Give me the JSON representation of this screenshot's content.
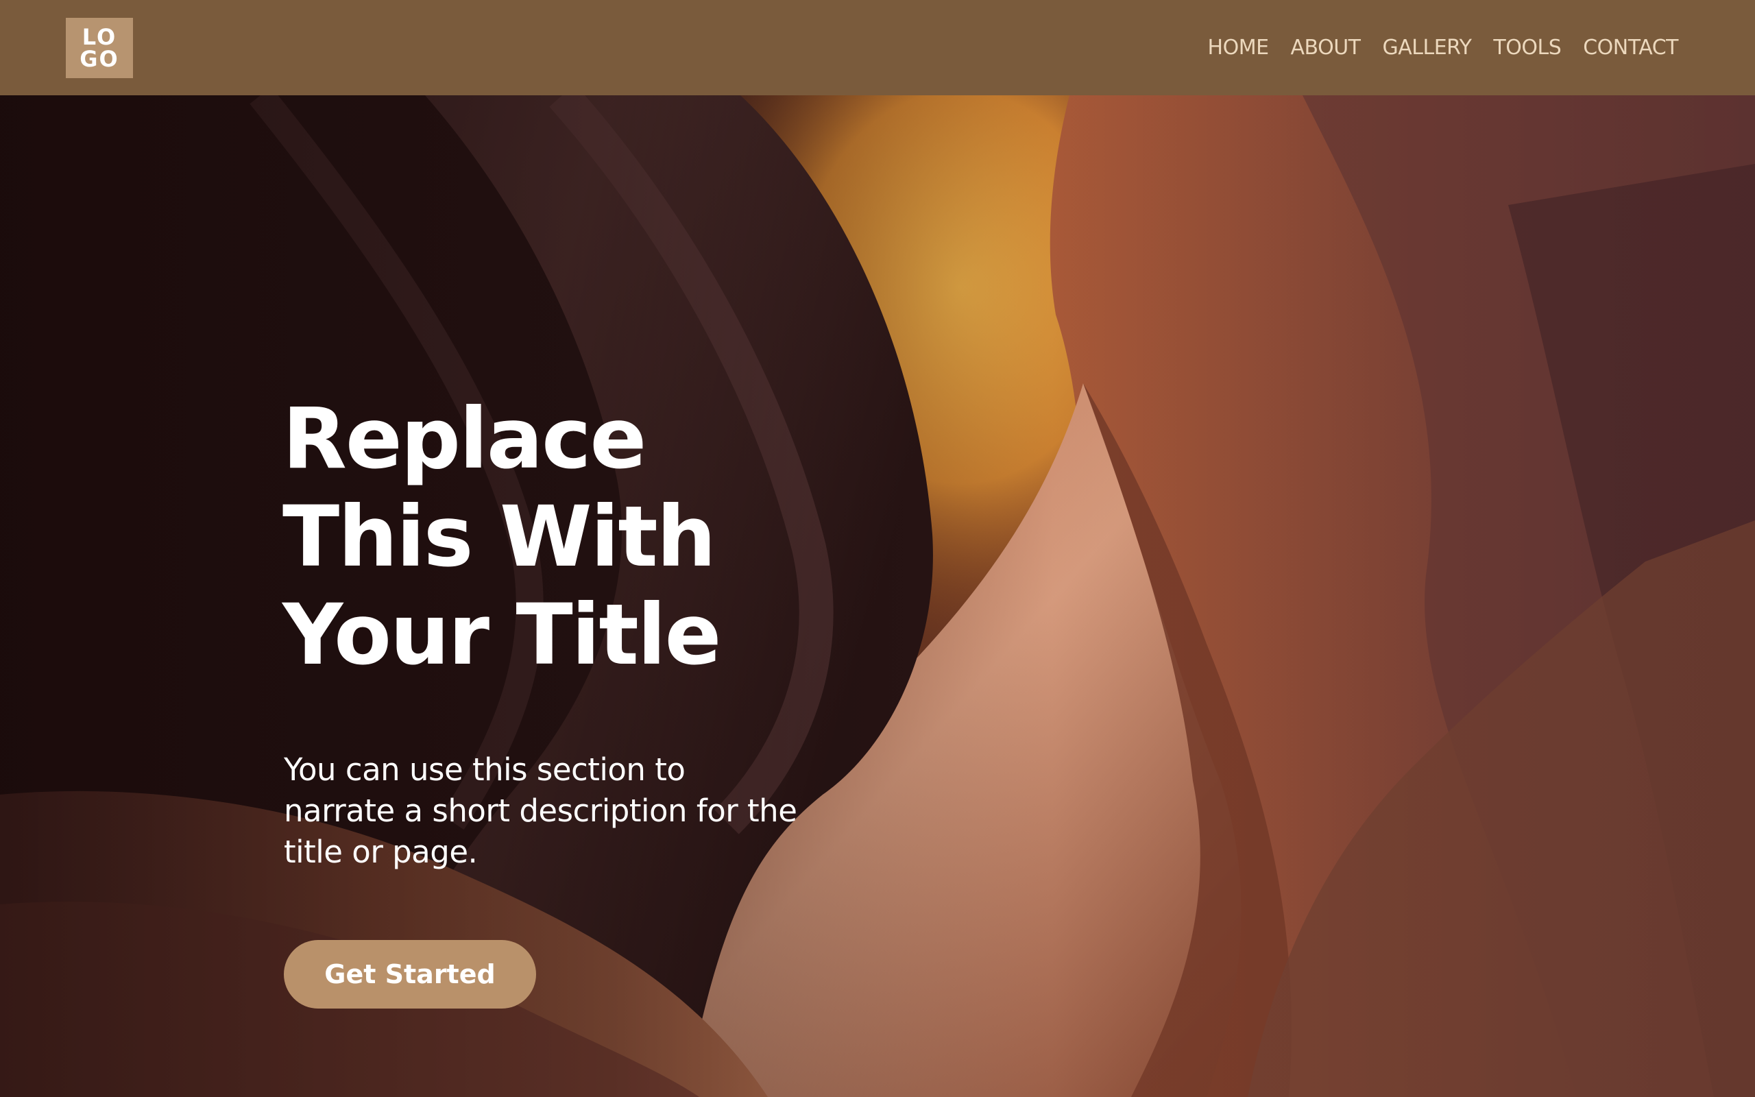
{
  "header": {
    "logo": {
      "line1": "LO",
      "line2": "GO"
    },
    "nav": [
      {
        "label": "HOME"
      },
      {
        "label": "ABOUT"
      },
      {
        "label": "GALLERY"
      },
      {
        "label": "TOOLS"
      },
      {
        "label": "CONTACT"
      }
    ]
  },
  "hero": {
    "title_line1": "Replace",
    "title_line2": "This With",
    "title_line3": "Your Title",
    "description": "You can use this section to narrate a short description for the title or page.",
    "cta_label": "Get Started"
  },
  "colors": {
    "header_bg": "#7a5b3c",
    "logo_bg": "#b79470",
    "nav_text": "#ecd8bd",
    "cta_bg": "#b9916a",
    "text": "#ffffff"
  },
  "icons": [
    "logo-mark"
  ]
}
